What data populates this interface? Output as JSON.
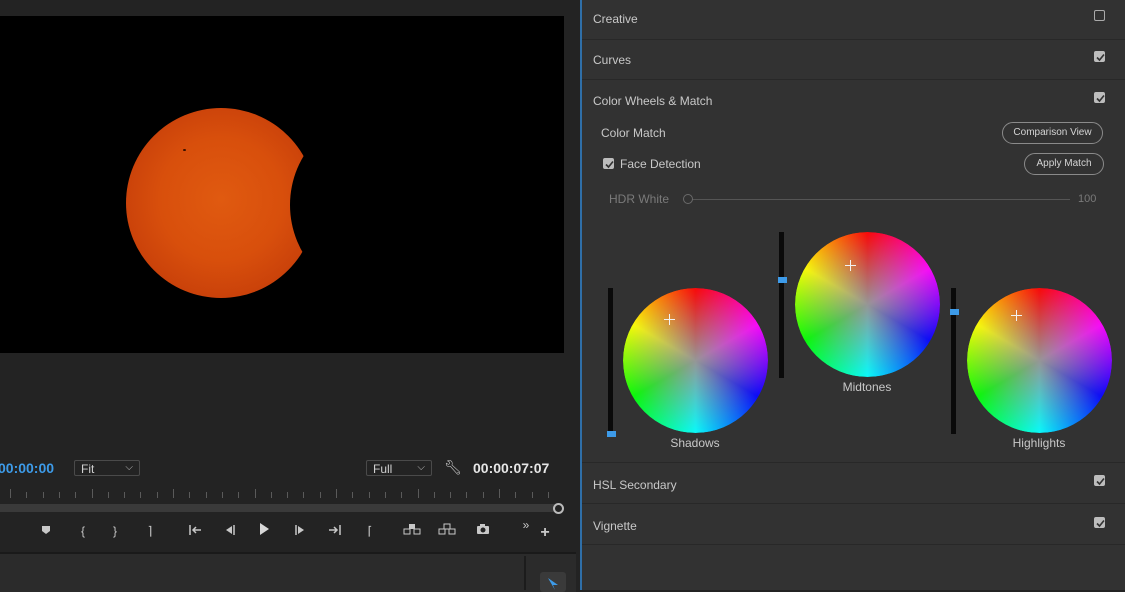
{
  "program_monitor": {
    "timecode_current": "00:00:00",
    "timecode_duration": "00:00:07:07",
    "zoom_select": "Fit",
    "resolution_select": "Full"
  },
  "transport": {
    "icons": [
      "marker-icon",
      "mark-in-icon",
      "mark-out-icon",
      "clear-in-out-icon",
      "go-to-in-icon",
      "step-back-icon",
      "play-icon",
      "step-forward-icon",
      "go-to-out-icon",
      "go-to-previous-edit-icon",
      "lift-icon",
      "extract-icon",
      "export-frame-icon",
      "more-controls-icon",
      "add-button-icon"
    ],
    "glyphs": [
      "⬟",
      "{",
      "}",
      "⌉",
      "|←",
      "◂|",
      "▶",
      "|▸",
      "→|",
      "⌈",
      "⇩",
      "⇪",
      "⌷",
      "»",
      "+"
    ]
  },
  "lumetri": {
    "sections": [
      {
        "label": "Creative",
        "checked": false
      },
      {
        "label": "Curves",
        "checked": true
      },
      {
        "label": "Color Wheels & Match",
        "checked": true
      },
      {
        "label": "HSL Secondary",
        "checked": true
      },
      {
        "label": "Vignette",
        "checked": true
      }
    ],
    "color_match_label": "Color Match",
    "comparison_view_label": "Comparison View",
    "face_detection_label": "Face Detection",
    "face_detection_checked": true,
    "apply_match_label": "Apply Match",
    "hdr_white_label": "HDR White",
    "hdr_white_value": "100",
    "wheels": {
      "shadows": "Shadows",
      "midtones": "Midtones",
      "highlights": "Highlights"
    }
  },
  "colors": {
    "accent_blue": "#3d9be9",
    "panel_bg": "#323232",
    "video_bg": "#000000",
    "sun_orange": "#d84f0c"
  }
}
